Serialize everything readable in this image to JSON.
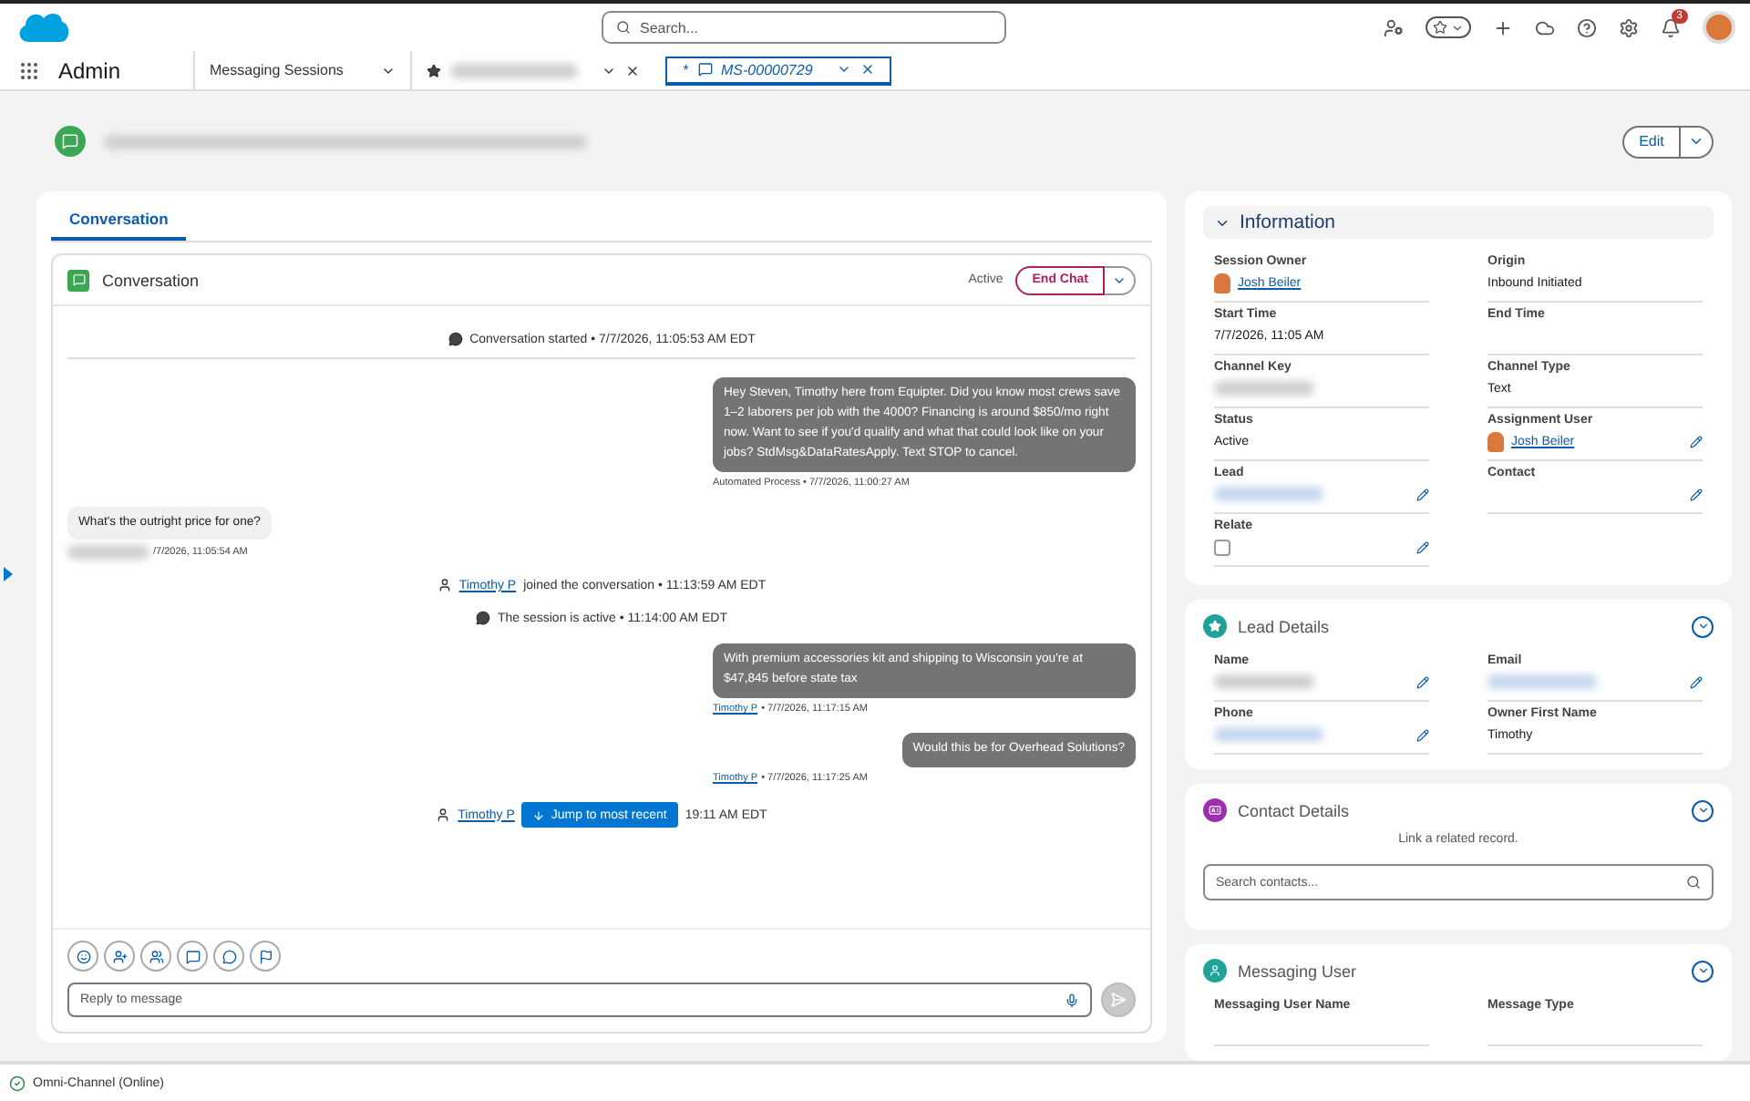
{
  "global_header": {
    "search": {
      "placeholder": "Search..."
    },
    "notification_count": "3"
  },
  "nav": {
    "app_name": "Admin",
    "tabs": [
      {
        "label": "Messaging Sessions",
        "kind": "object",
        "selected": false
      },
      {
        "kind": "record",
        "redacted": true,
        "selected": false
      },
      {
        "label": "MS-00000729",
        "prefix": "*",
        "kind": "record",
        "redacted": false,
        "selected": true
      }
    ]
  },
  "record_header": {
    "title_redacted": true,
    "edit_button": "Edit"
  },
  "main_tabs": [
    {
      "label": "Conversation",
      "selected": true
    }
  ],
  "conversation": {
    "title": "Conversation",
    "status": "Active",
    "end_button": "End Chat",
    "jump_button": "Jump to most recent",
    "reply_placeholder": "Reply to message",
    "items": [
      {
        "kind": "event",
        "text": "Conversation started • 7/7/2026, 11:05:53 AM EDT"
      },
      {
        "kind": "outbound",
        "text": "Hey Steven, Timothy here from Equipter. Did you know most crews save 1–2 laborers per job with the 4000? Financing is around $850/mo right now. Want to see if you'd qualify and what that could look like on your jobs? StdMsg&DataRatesApply. Text STOP to cancel.",
        "meta": "Automated Process • 7/7/2026, 11:00:27 AM"
      },
      {
        "kind": "inbound",
        "text": "What's the outright price for one?",
        "sender_redacted": true,
        "meta": "/7/2026, 11:05:54 AM"
      },
      {
        "kind": "agent_event",
        "link": "Timothy P",
        "text": "joined the conversation • 11:13:59 AM EDT"
      },
      {
        "kind": "event",
        "text": "The session is active • 11:14:00 AM EDT"
      },
      {
        "kind": "outbound",
        "text": "With premium accessories kit and shipping to Wisconsin you're at $47,845 before state tax",
        "author": "Timothy P",
        "meta": "• 7/7/2026, 11:17:15 AM"
      },
      {
        "kind": "outbound",
        "text": "Would this be for Overhead Solutions?",
        "author": "Timothy P",
        "meta": "• 7/7/2026, 11:17:25 AM"
      },
      {
        "kind": "agent_event",
        "link": "Timothy P",
        "text": "19:11 AM EDT",
        "jump": true
      }
    ]
  },
  "information": {
    "title": "Information",
    "expanded": true,
    "fields": [
      {
        "label": "Session Owner",
        "kind": "user",
        "value": "Josh Beiler",
        "editable": false
      },
      {
        "label": "Origin",
        "kind": "text",
        "value": "Inbound Initiated",
        "editable": false
      },
      {
        "label": "Start Time",
        "kind": "text",
        "value": "7/7/2026, 11:05 AM",
        "editable": false
      },
      {
        "label": "End Time",
        "kind": "empty",
        "editable": false
      },
      {
        "label": "Channel Key",
        "kind": "redacted",
        "editable": false
      },
      {
        "label": "Channel Type",
        "kind": "text",
        "value": "Text",
        "editable": false
      },
      {
        "label": "Status",
        "kind": "text",
        "value": "Active",
        "editable": false
      },
      {
        "label": "Assignment User",
        "kind": "user",
        "value": "Josh Beiler",
        "editable": true
      },
      {
        "label": "Lead",
        "kind": "redacted_link",
        "editable": true
      },
      {
        "label": "Contact",
        "kind": "empty",
        "editable": true
      },
      {
        "label": "Relate",
        "kind": "checkbox",
        "checked": false,
        "editable": true
      }
    ]
  },
  "lead_details": {
    "title": "Lead Details",
    "fields": [
      {
        "label": "Name",
        "kind": "redacted",
        "editable": true
      },
      {
        "label": "Email",
        "kind": "redacted_link",
        "editable": true
      },
      {
        "label": "Phone",
        "kind": "redacted_link",
        "editable": true
      },
      {
        "label": "Owner First Name",
        "kind": "text",
        "value": "Timothy",
        "editable": false
      }
    ]
  },
  "contact_details": {
    "title": "Contact Details",
    "message": "Link a related record.",
    "search": {
      "placeholder": "Search contacts..."
    }
  },
  "messaging_user": {
    "title": "Messaging User",
    "field_labels": [
      "Messaging User Name",
      "Message Type"
    ]
  },
  "utility_bar": {
    "label": "Omni-Channel (Online)"
  }
}
